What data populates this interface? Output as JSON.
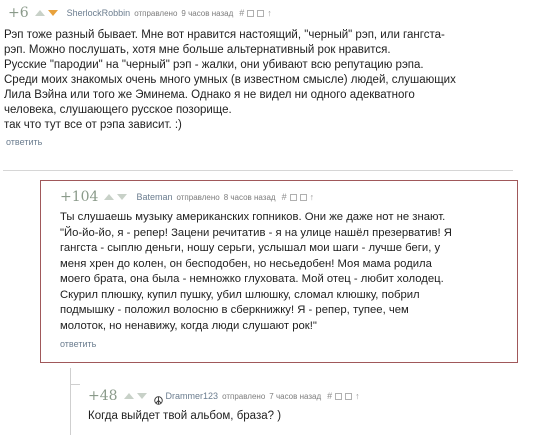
{
  "comments": [
    {
      "score": "+6",
      "author": "SherlockRobbin",
      "sent": "отправлено",
      "time": "9 часов назад",
      "body": "Рэп тоже разный бывает. Мне вот нравится настоящий, \"черный\" рэп, или гангста-\nрэп. Можно послушать, хотя мне больше альтернативный рок нравится.\nРусские \"пародии\" на \"черный\" рэп - жалки, они убивают всю репутацию рэпа.\nСреди моих знакомых очень много умных (в известном смысле) людей, слушающих\nЛила Вэйна или того же Эминема. Однако я не видел ни одного адекватного\nчеловека, слушающего русское позорище.\nтак что тут все от рэпа зависит. :)",
      "reply": "ответить"
    },
    {
      "score": "+104",
      "author": "Bateman",
      "sent": "отправлено",
      "time": "8 часов назад",
      "body": "Ты слушаешь музыку американских гопников. Они же даже нот не знают.\n\"Йо-йо-йо, я - репер! Зацени речитатив - я на улице нашёл презерватив! Я\nгангста - сыплю деньги, ношу серьги, услышал мои шаги - лучше беги, у\nменя хрен до колен, он бесподобен, но несьедобен! Моя мама родила\nмоего брата, она была - немножко глуховата. Мой отец - любит холодец.\nСкурил плюшку, купил пушку, убил шлюшку, сломал клюшку, побрил\nподмышку - положил волосню в сберкнижку! Я - репер, тупее, чем\nмолоток, но ненавижу, когда люди слушают рок!\"",
      "reply": "ответить"
    },
    {
      "score": "+48",
      "author": "Drammer123",
      "sent": "отправлено",
      "time": "7 часов назад",
      "body": "Когда выйдет твой альбом, браза? )"
    }
  ],
  "icons": {
    "hash": "#",
    "up": "↑",
    "avatar": "peace-icon"
  }
}
